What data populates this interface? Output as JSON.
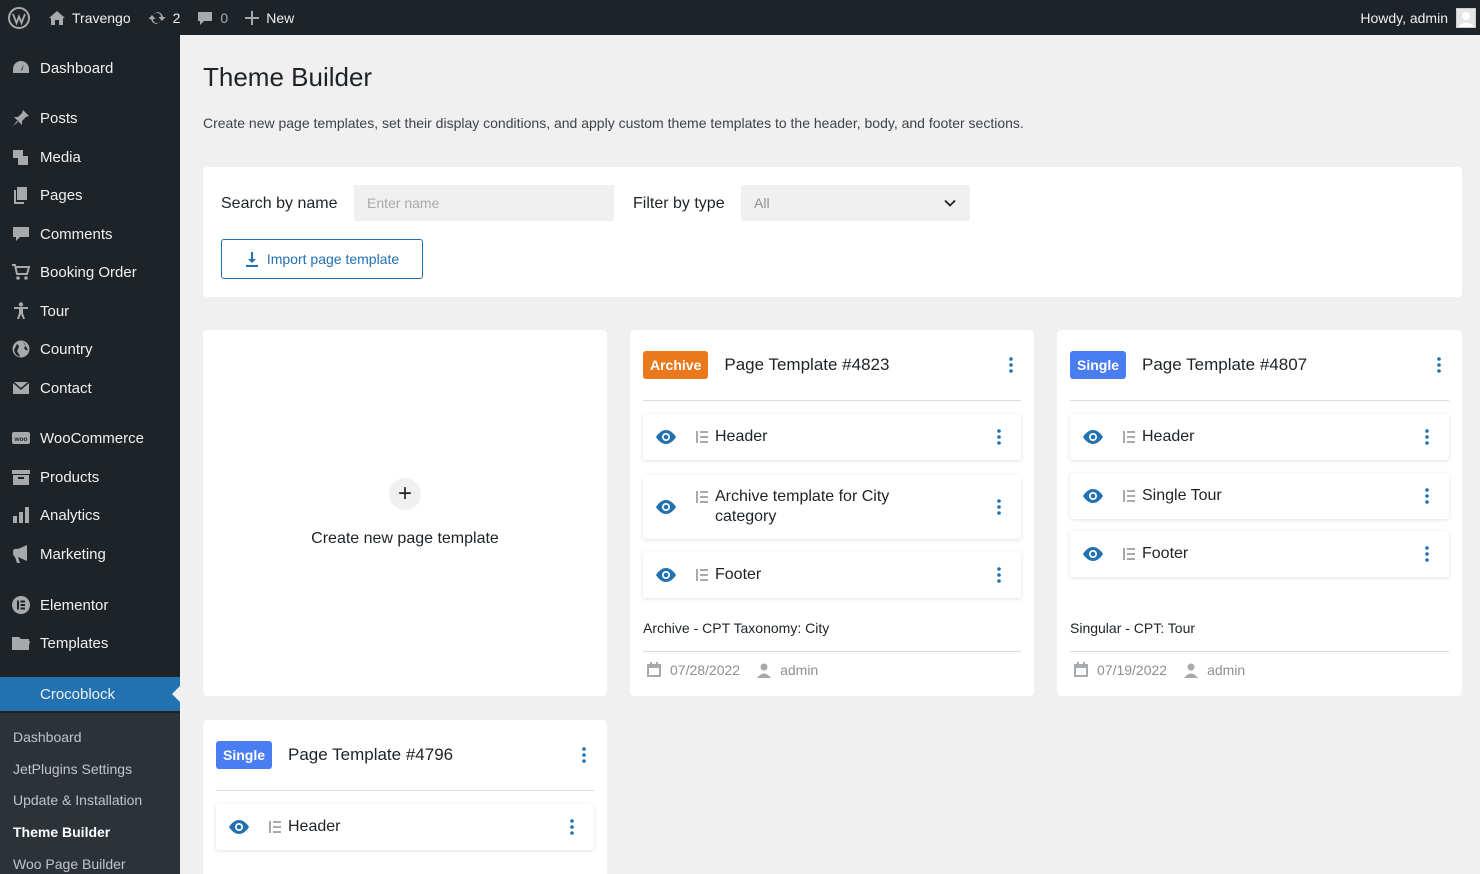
{
  "adminbar": {
    "site_name": "Travengo",
    "updates_count": "2",
    "comments_count": "0",
    "new_label": "New",
    "howdy": "Howdy, admin"
  },
  "sidebar": {
    "items": [
      {
        "label": "Dashboard",
        "icon": "dashboard-icon"
      },
      {
        "label": "Posts",
        "icon": "pin-icon"
      },
      {
        "label": "Media",
        "icon": "media-icon"
      },
      {
        "label": "Pages",
        "icon": "pages-icon"
      },
      {
        "label": "Comments",
        "icon": "comment-icon"
      },
      {
        "label": "Booking Order",
        "icon": "cart-icon"
      },
      {
        "label": "Tour",
        "icon": "person-icon"
      },
      {
        "label": "Country",
        "icon": "globe-icon"
      },
      {
        "label": "Contact",
        "icon": "mail-icon"
      },
      {
        "label": "WooCommerce",
        "icon": "woo-icon"
      },
      {
        "label": "Products",
        "icon": "archive-icon"
      },
      {
        "label": "Analytics",
        "icon": "bar-chart-icon"
      },
      {
        "label": "Marketing",
        "icon": "megaphone-icon"
      },
      {
        "label": "Elementor",
        "icon": "elementor-icon"
      },
      {
        "label": "Templates",
        "icon": "folder-icon"
      },
      {
        "label": "Crocoblock",
        "icon": "crocoblock-icon"
      }
    ],
    "submenu": [
      {
        "label": "Dashboard"
      },
      {
        "label": "JetPlugins Settings"
      },
      {
        "label": "Update & Installation"
      },
      {
        "label": "Theme Builder"
      },
      {
        "label": "Woo Page Builder"
      }
    ]
  },
  "main": {
    "title": "Theme Builder",
    "description": "Create new page templates, set their display conditions, and apply custom theme templates to the header, body, and footer sections.",
    "filters": {
      "search_label": "Search by name",
      "search_placeholder": "Enter name",
      "type_label": "Filter by type",
      "type_value": "All",
      "import_label": "Import page template"
    },
    "create_label": "Create new page template",
    "cards": [
      {
        "badge": "Archive",
        "badge_color": "#e9791c",
        "title": "Page Template #4823",
        "sections": [
          {
            "label": "Header"
          },
          {
            "label": "Archive template for City category"
          },
          {
            "label": "Footer"
          }
        ],
        "condition": "Archive - CPT Taxonomy: City",
        "date": "07/28/2022",
        "author": "admin"
      },
      {
        "badge": "Single",
        "badge_color": "#4a7cf2",
        "title": "Page Template #4807",
        "sections": [
          {
            "label": "Header"
          },
          {
            "label": "Single Tour"
          },
          {
            "label": "Footer"
          }
        ],
        "condition": "Singular - CPT: Tour",
        "date": "07/19/2022",
        "author": "admin"
      },
      {
        "badge": "Single",
        "badge_color": "#4a7cf2",
        "title": "Page Template #4796",
        "sections": [
          {
            "label": "Header"
          }
        ]
      }
    ]
  }
}
